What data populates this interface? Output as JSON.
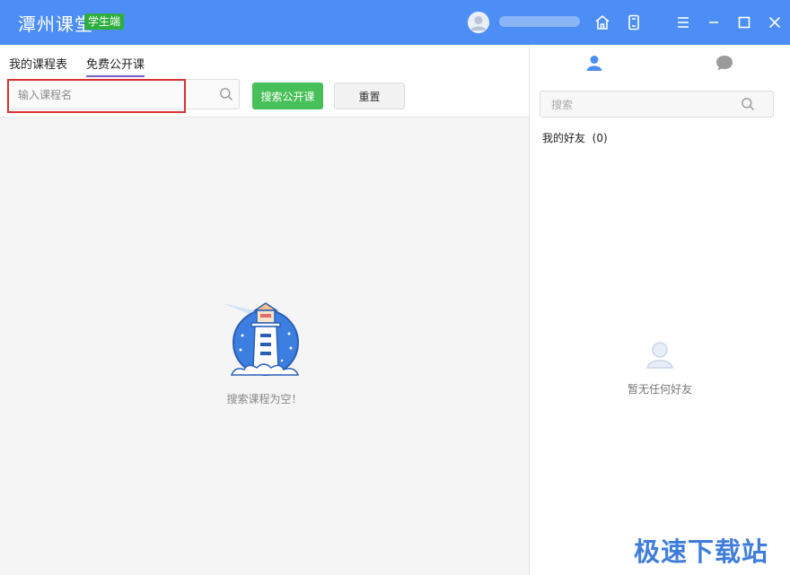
{
  "app": {
    "title": "潭州课堂",
    "badge": "学生端",
    "username": ""
  },
  "left": {
    "tabs": [
      {
        "label": "我的课程表",
        "active": false
      },
      {
        "label": "免费公开课",
        "active": true
      }
    ],
    "search": {
      "placeholder": "输入课程名",
      "value": ""
    },
    "search_button": "搜索公开课",
    "reset_button": "重置",
    "empty_text": "搜索课程为空！"
  },
  "right": {
    "search": {
      "placeholder": "搜索",
      "value": ""
    },
    "friends_title": "我的好友",
    "friends_count": "(0)",
    "empty_text": "暂无任何好友"
  },
  "watermark": "极速下载站",
  "colors": {
    "titlebar": "#4c8ef5",
    "badge": "#2fae3f",
    "search_button": "#48c05a",
    "highlight": "#d6322f",
    "active_tab_underline": "#7a5ec6"
  }
}
